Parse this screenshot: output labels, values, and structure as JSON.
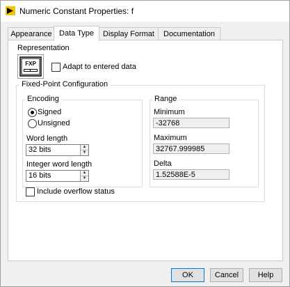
{
  "window": {
    "title": "Numeric Constant Properties: f"
  },
  "tabs": [
    {
      "label": "Appearance"
    },
    {
      "label": "Data Type"
    },
    {
      "label": "Display Format"
    },
    {
      "label": "Documentation"
    }
  ],
  "active_tab": "Data Type",
  "representation": {
    "heading": "Representation",
    "icon_text": "FXP",
    "adapt_label": "Adapt to entered data",
    "adapt_checked": false
  },
  "fixed_point": {
    "heading": "Fixed-Point Configuration",
    "encoding": {
      "heading": "Encoding",
      "signed_label": "Signed",
      "unsigned_label": "Unsigned",
      "selected": "Signed"
    },
    "word_length": {
      "label": "Word length",
      "value": "32 bits"
    },
    "integer_word_length": {
      "label": "Integer word length",
      "value": "16 bits"
    },
    "range": {
      "heading": "Range",
      "minimum_label": "Minimum",
      "minimum_value": "-32768",
      "maximum_label": "Maximum",
      "maximum_value": "32767.999985",
      "delta_label": "Delta",
      "delta_value": "1.52588E-5"
    },
    "overflow_label": "Include overflow status",
    "overflow_checked": false
  },
  "buttons": {
    "ok": "OK",
    "cancel": "Cancel",
    "help": "Help"
  },
  "colors": {
    "app_icon_yellow": "#f5c400",
    "default_button_border": "#0078d7"
  }
}
